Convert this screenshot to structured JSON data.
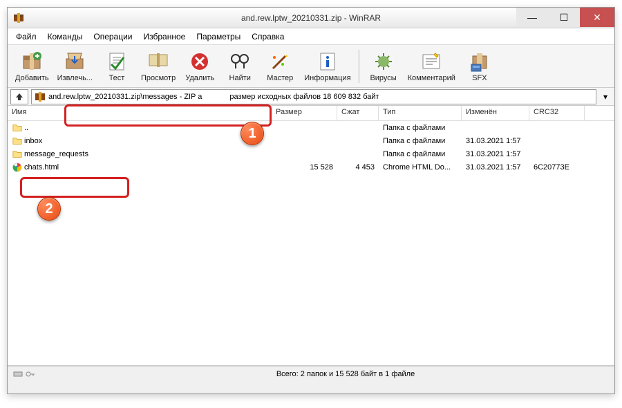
{
  "title": "and.rew.lptw_20210331.zip - WinRAR",
  "menu": [
    "Файл",
    "Команды",
    "Операции",
    "Избранное",
    "Параметры",
    "Справка"
  ],
  "toolbar": [
    {
      "label": "Добавить",
      "icon": "add"
    },
    {
      "label": "Извлечь...",
      "icon": "extract"
    },
    {
      "label": "Тест",
      "icon": "test"
    },
    {
      "label": "Просмотр",
      "icon": "view"
    },
    {
      "label": "Удалить",
      "icon": "delete"
    },
    {
      "label": "Найти",
      "icon": "find"
    },
    {
      "label": "Мастер",
      "icon": "wizard"
    },
    {
      "label": "Информация",
      "icon": "info"
    },
    {
      "label": "Вирусы",
      "icon": "virus"
    },
    {
      "label": "Комментарий",
      "icon": "comment"
    },
    {
      "label": "SFX",
      "icon": "sfx"
    }
  ],
  "address": {
    "path": "and.rew.lptw_20210331.zip\\messages - ZIP а",
    "info": "размер исходных файлов 18 609 832 байт"
  },
  "columns": [
    "Имя",
    "Размер",
    "Сжат",
    "Тип",
    "Изменён",
    "CRC32"
  ],
  "files": [
    {
      "name": "..",
      "icon": "folder",
      "size": "",
      "packed": "",
      "type": "Папка с файлами",
      "modified": "",
      "crc": ""
    },
    {
      "name": "inbox",
      "icon": "folder",
      "size": "",
      "packed": "",
      "type": "Папка с файлами",
      "modified": "31.03.2021 1:57",
      "crc": ""
    },
    {
      "name": "message_requests",
      "icon": "folder",
      "size": "",
      "packed": "",
      "type": "Папка с файлами",
      "modified": "31.03.2021 1:57",
      "crc": ""
    },
    {
      "name": "chats.html",
      "icon": "chrome",
      "size": "15 528",
      "packed": "4 453",
      "type": "Chrome HTML Do...",
      "modified": "31.03.2021 1:57",
      "crc": "6C20773E"
    }
  ],
  "status": "Всего: 2 папок и 15 528 байт в 1 файле",
  "badges": {
    "b1": "1",
    "b2": "2"
  }
}
